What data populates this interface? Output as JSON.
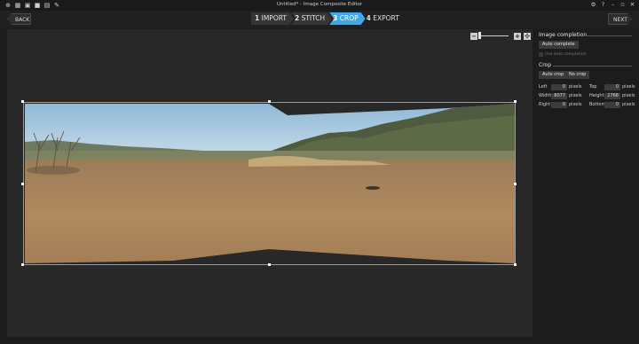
{
  "titlebar": {
    "title": "Untitled* - Image Composite Editor",
    "icons": [
      "new-project-icon",
      "new-panorama-icon",
      "new-video-panorama-icon",
      "open-icon",
      "save-icon",
      "export-icon"
    ],
    "controls": [
      "settings-icon",
      "help-icon",
      "minimize-icon",
      "maximize-icon",
      "close-icon"
    ]
  },
  "stepbar": {
    "back_label": "BACK",
    "next_label": "NEXT",
    "steps": [
      {
        "num": "1",
        "label": "IMPORT"
      },
      {
        "num": "2",
        "label": "STITCH"
      },
      {
        "num": "3",
        "label": "CROP"
      },
      {
        "num": "4",
        "label": "EXPORT"
      }
    ],
    "active_step": 3
  },
  "zoom": {
    "minus": "−",
    "plus": "+",
    "fit": "✣",
    "level": 0.25
  },
  "panel": {
    "completion": {
      "title": "Image completion",
      "auto_complete_label": "Auto complete",
      "use_auto_label": "Use auto completion"
    },
    "crop": {
      "title": "Crop",
      "auto_crop_label": "Auto crop",
      "no_crop_label": "No crop",
      "left_label": "Left",
      "left_value": "0",
      "left_unit": "pixels",
      "top_label": "Top",
      "top_value": "0",
      "top_unit": "pixels",
      "width_label": "Width",
      "width_value": "8077",
      "width_unit": "pixels",
      "height_label": "Height",
      "height_value": "2768",
      "height_unit": "pixels",
      "right_label": "Right",
      "right_value": "0",
      "right_unit": "pixels",
      "bottom_label": "Bottom",
      "bottom_value": "0",
      "bottom_unit": "pixels"
    }
  },
  "colors": {
    "accent": "#3ea8e8",
    "sky": "#9cc3e0",
    "ground": "#a8825a"
  }
}
